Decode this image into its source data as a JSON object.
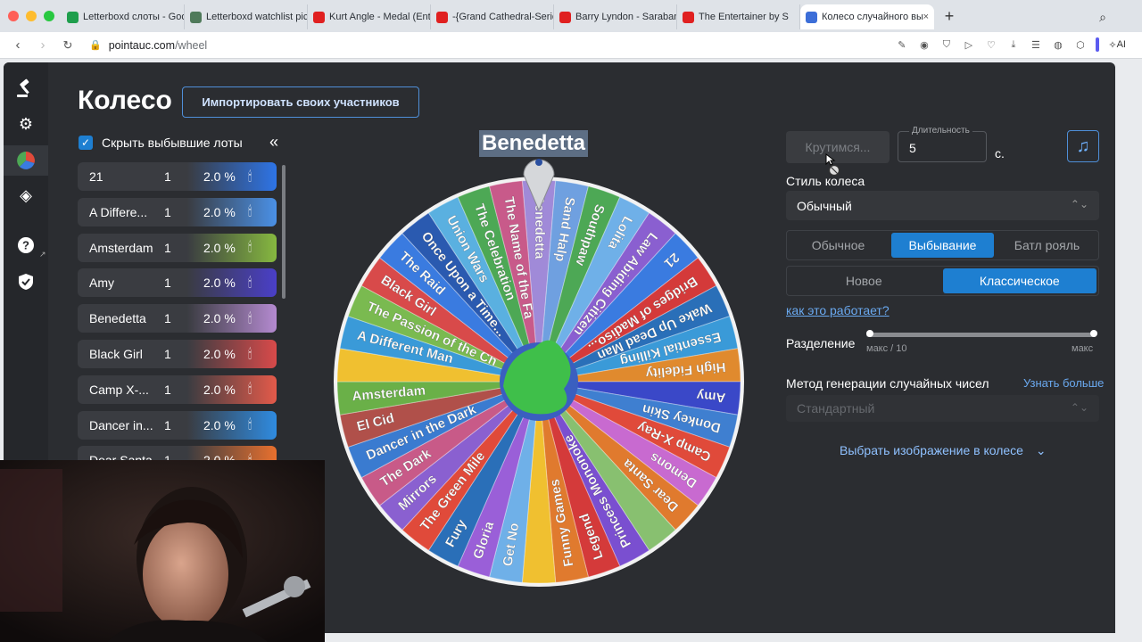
{
  "browser": {
    "tabs": [
      {
        "label": "Letterboxd слоты - Goo",
        "icon": "sheets-icon",
        "color": "#1e9e4c"
      },
      {
        "label": "Letterboxd watchlist pic",
        "icon": "globe-icon",
        "color": "#4f7a5a"
      },
      {
        "label": "Kurt Angle - Medal (Ent",
        "icon": "youtube-icon",
        "color": "#e02020"
      },
      {
        "label": "-{Grand Cathedral-Serio",
        "icon": "youtube-icon",
        "color": "#e02020"
      },
      {
        "label": "Barry Lyndon - Saraban",
        "icon": "youtube-icon",
        "color": "#e02020"
      },
      {
        "label": "The Entertainer by S",
        "icon": "youtube-icon",
        "color": "#e02020"
      },
      {
        "label": "Колесо случайного вы",
        "icon": "wheel-icon",
        "color": "#3c6ed8"
      }
    ],
    "url_host": "pointauc.com",
    "url_path": "/wheel",
    "ai_label": "AI"
  },
  "header": {
    "title": "Колесо",
    "import_button": "Импортировать своих участников"
  },
  "hide_eliminated": {
    "label": "Скрыть выбывшие лоты",
    "checked": true
  },
  "lots": [
    {
      "name": "21",
      "count": "1",
      "percent": "2.0 %",
      "color": "#2e74e6"
    },
    {
      "name": "A Differe...",
      "count": "1",
      "percent": "2.0 %",
      "color": "#4a90e6"
    },
    {
      "name": "Amsterdam",
      "count": "1",
      "percent": "2.0 %",
      "color": "#86b840"
    },
    {
      "name": "Amy",
      "count": "1",
      "percent": "2.0 %",
      "color": "#4a3fc8"
    },
    {
      "name": "Benedetta",
      "count": "1",
      "percent": "2.0 %",
      "color": "#b48ad0"
    },
    {
      "name": "Black Girl",
      "count": "1",
      "percent": "2.0 %",
      "color": "#d84a4a"
    },
    {
      "name": "Camp X-...",
      "count": "1",
      "percent": "2.0 %",
      "color": "#e35a4a"
    },
    {
      "name": "Dancer in...",
      "count": "1",
      "percent": "2.0 %",
      "color": "#2f8be0"
    },
    {
      "name": "Dear Santa",
      "count": "1",
      "percent": "2.0 %",
      "color": "#e8702e"
    }
  ],
  "wheel": {
    "winner": "Benedetta",
    "segments": [
      {
        "label": "Benedetta",
        "color": "#a08ad8"
      },
      {
        "label": "Sand Halp",
        "color": "#6fa0e0"
      },
      {
        "label": "Southpaw",
        "color": "#4da855"
      },
      {
        "label": "Lolita",
        "color": "#6fb0e8"
      },
      {
        "label": "Law Abiding Citizen",
        "color": "#8a5fd0"
      },
      {
        "label": "21",
        "color": "#3a7be0"
      },
      {
        "label": "Bridges of Madiso...",
        "color": "#d43a3a"
      },
      {
        "label": "Wake Up Dead Man",
        "color": "#2a6fb8"
      },
      {
        "label": "Essential Killing",
        "color": "#3a9ad8"
      },
      {
        "label": "High Fidelity",
        "color": "#e08a2e"
      },
      {
        "label": "Amy",
        "color": "#3a48c8"
      },
      {
        "label": "Donkey Skin",
        "color": "#3f7fd0"
      },
      {
        "label": "Camp X-Ray",
        "color": "#e04a3a"
      },
      {
        "label": "Demons",
        "color": "#c86ad0"
      },
      {
        "label": "Dear Santa",
        "color": "#e07a2e"
      },
      {
        "label": "",
        "color": "#88c070"
      },
      {
        "label": "Princess Mononoke",
        "color": "#7a4fd0"
      },
      {
        "label": "Legend",
        "color": "#d43a3a"
      },
      {
        "label": "Funny Games",
        "color": "#e07a2e"
      },
      {
        "label": "",
        "color": "#f0c030"
      },
      {
        "label": "Get No",
        "color": "#6fb0e8"
      },
      {
        "label": "Gloria",
        "color": "#9a5fd8"
      },
      {
        "label": "Fury",
        "color": "#2a6fb8"
      },
      {
        "label": "The Green Mile",
        "color": "#e04a3a"
      },
      {
        "label": "Mirrors",
        "color": "#8a60d0"
      },
      {
        "label": "The Dark",
        "color": "#c85a88"
      },
      {
        "label": "Dancer in the Dark",
        "color": "#3a7bd0"
      },
      {
        "label": "El Cid",
        "color": "#b0504a"
      },
      {
        "label": "Amsterdam",
        "color": "#6ab048"
      },
      {
        "label": "",
        "color": "#f0c030"
      },
      {
        "label": "A Different Man",
        "color": "#3a9ad8"
      },
      {
        "label": "The Passion of the Ch",
        "color": "#7aba50"
      },
      {
        "label": "Black Girl",
        "color": "#d84a4a"
      },
      {
        "label": "The Raid",
        "color": "#3a7be0"
      },
      {
        "label": "Once Upon a Time...",
        "color": "#2a5ab0"
      },
      {
        "label": "Union Wars",
        "color": "#5ab0e0"
      },
      {
        "label": "The Celebration",
        "color": "#4da855"
      },
      {
        "label": "The Name of the Fa",
        "color": "#c85a8a"
      }
    ]
  },
  "controls": {
    "spin_button": "Крутимся...",
    "duration_label": "Длительность",
    "duration_value": "5",
    "seconds_unit": "с.",
    "wheel_style_label": "Стиль колеса",
    "wheel_style_value": "Обычный",
    "modes": [
      "Обычное",
      "Выбывание",
      "Батл рояль"
    ],
    "mode_selected": "Выбывание",
    "variants": [
      "Новое",
      "Классическое"
    ],
    "variant_selected": "Классическое",
    "how_link": "как это работает?",
    "split_label": "Разделение",
    "split_min": "макс / 10",
    "split_max": "макс",
    "rng_label": "Метод генерации случайных чисел",
    "rng_more": "Узнать больше",
    "rng_value": "Стандартный",
    "choose_image": "Выбрать изображение в колесе"
  }
}
